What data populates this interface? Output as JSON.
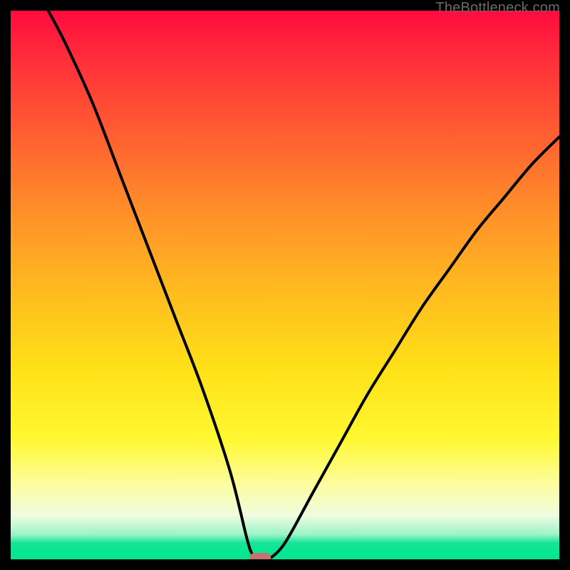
{
  "watermark": "TheBottleneck.com",
  "chart_data": {
    "type": "line",
    "title": "",
    "xlabel": "",
    "ylabel": "",
    "xlim": [
      0,
      100
    ],
    "ylim": [
      0,
      100
    ],
    "x": [
      0,
      5,
      10,
      15,
      20,
      25,
      30,
      35,
      40,
      43,
      44,
      45,
      46,
      47,
      50,
      55,
      60,
      65,
      70,
      75,
      80,
      85,
      90,
      95,
      100
    ],
    "values": [
      100,
      100,
      94,
      83,
      70,
      57,
      44,
      31,
      16,
      4,
      1,
      0,
      0,
      0,
      3,
      12,
      21,
      30,
      38,
      46,
      53,
      60,
      66,
      72,
      77
    ],
    "optimum_x": 45.5,
    "marker": {
      "x": 45.5,
      "y": 0
    },
    "background_gradient": {
      "top": "#ff0b3e",
      "mid_upper": "#ff8a2a",
      "mid": "#ffe018",
      "mid_lower": "#fdfd9a",
      "bottom": "#00e78f"
    }
  }
}
